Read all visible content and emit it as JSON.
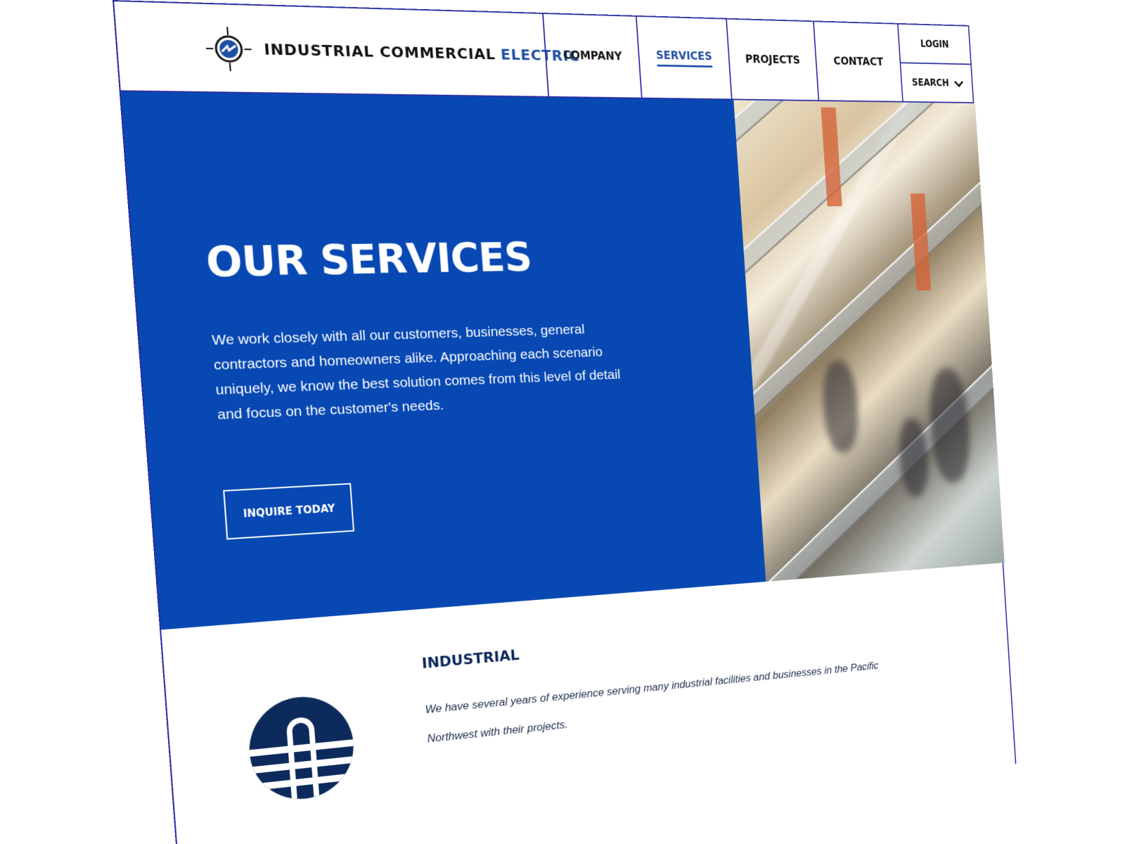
{
  "brand": {
    "name_main": "INDUSTRIAL COMMERCIAL",
    "name_accent": "ELECTRIC"
  },
  "nav": {
    "items": [
      {
        "label": "COMPANY",
        "active": false
      },
      {
        "label": "SERVICES",
        "active": true
      },
      {
        "label": "PROJECTS",
        "active": false
      },
      {
        "label": "CONTACT",
        "active": false
      }
    ],
    "login_label": "LOGIN",
    "search_label": "SEARCH"
  },
  "hero": {
    "title": "OUR SERVICES",
    "body": "We work closely with all our customers, businesses, general contractors and homeowners alike. Approaching each scenario uniquely, we know the best solution comes from this level of detail and focus on the customer's needs.",
    "cta_label": "INQUIRE TODAY",
    "background_color": "#0748b3"
  },
  "industrial": {
    "title": "INDUSTRIAL",
    "text": "We have several years of experience serving many industrial facilities and businesses in the Pacific Northwest with their projects."
  },
  "icons": [
    "compass-logo-icon",
    "chevron-down-icon",
    "industrial-service-icon"
  ],
  "colors": {
    "accent": "#1f4fa3",
    "navy": "#0d2a5c",
    "border": "#2a2fa0"
  }
}
